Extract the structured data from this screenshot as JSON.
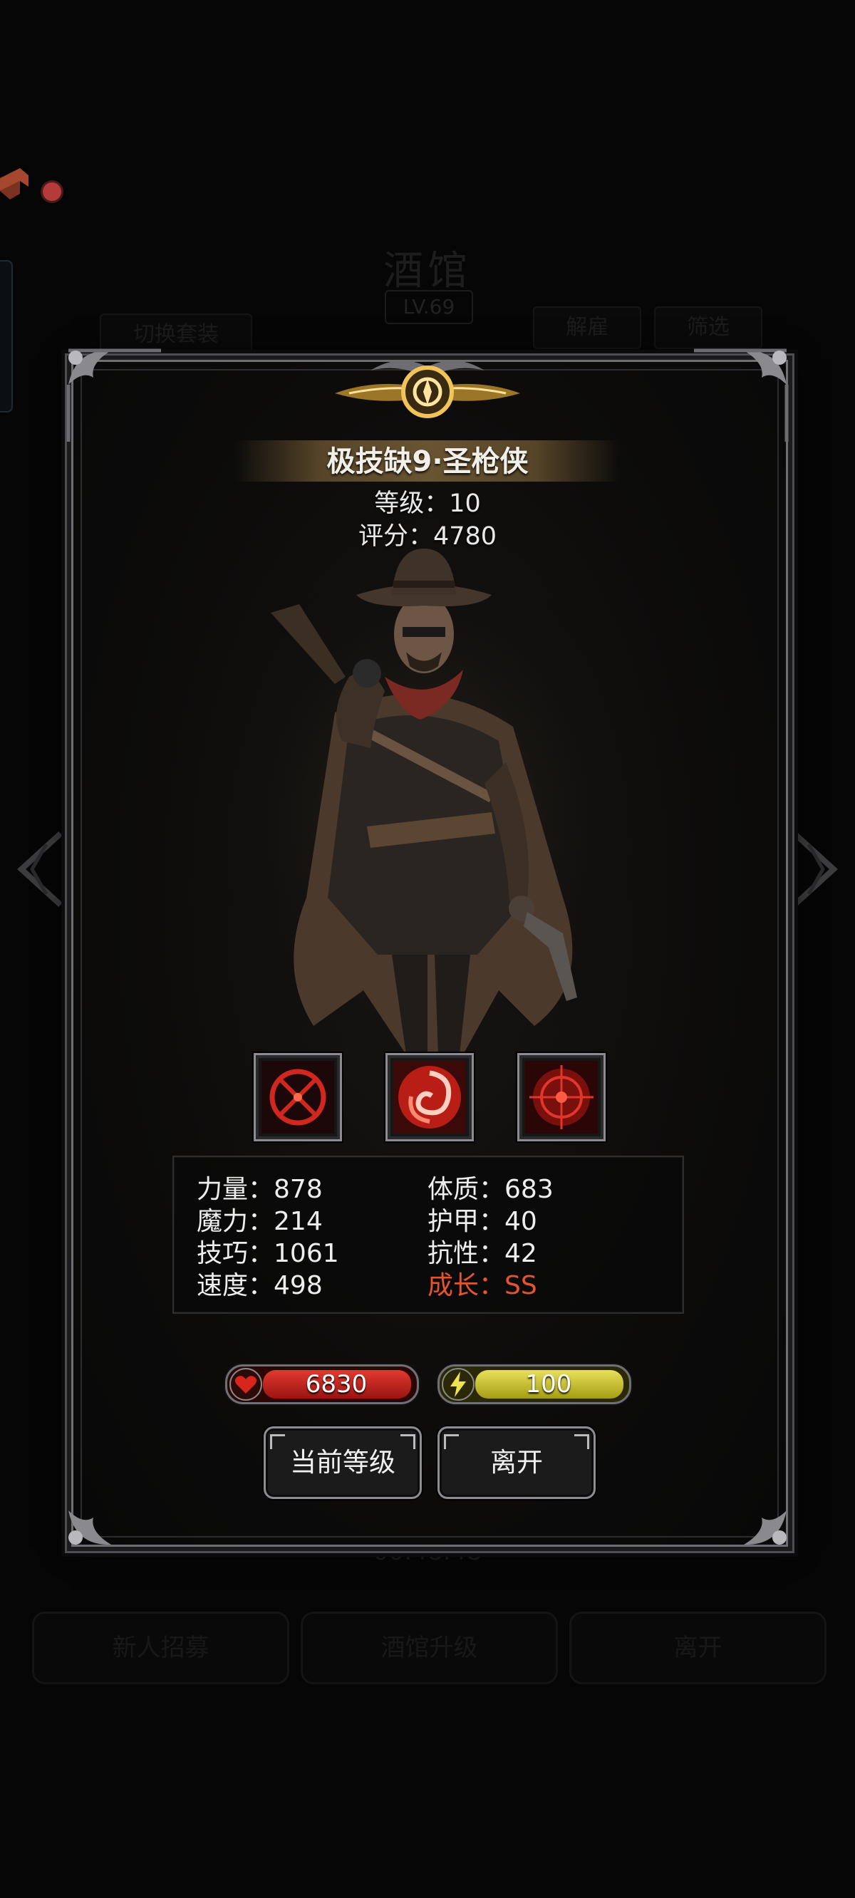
{
  "background": {
    "title": "酒馆",
    "level": "LV.69",
    "tabs": [
      "切换套装",
      "解雇",
      "筛选"
    ],
    "timer": "00:48:48",
    "buttons": [
      "新人招募",
      "酒馆升级",
      "离开"
    ]
  },
  "hero": {
    "name": "极技缺9·圣枪侠",
    "level_label": "等级",
    "level_value": "10",
    "score_label": "评分",
    "score_value": "4780"
  },
  "skills": [
    {
      "icon": "crosshair-skill-icon"
    },
    {
      "icon": "swirl-skill-icon"
    },
    {
      "icon": "target-skill-icon"
    }
  ],
  "stats": {
    "strength": {
      "label": "力量",
      "value": "878"
    },
    "magic": {
      "label": "魔力",
      "value": "214"
    },
    "skill": {
      "label": "技巧",
      "value": "1061"
    },
    "speed": {
      "label": "速度",
      "value": "498"
    },
    "constitution": {
      "label": "体质",
      "value": "683"
    },
    "armor": {
      "label": "护甲",
      "value": "40"
    },
    "resistance": {
      "label": "抗性",
      "value": "42"
    },
    "growth": {
      "label": "成长",
      "value": "SS"
    }
  },
  "resources": {
    "hp": {
      "value": "6830",
      "icon": "heart-icon",
      "color": "#c8221f"
    },
    "energy": {
      "value": "100",
      "icon": "lightning-icon",
      "color": "#c9c21e"
    }
  },
  "actions": {
    "current_level": "当前等级",
    "leave": "离开"
  },
  "colors": {
    "growth_text": "#e3542f",
    "notification_dot": "#b53a3a"
  }
}
